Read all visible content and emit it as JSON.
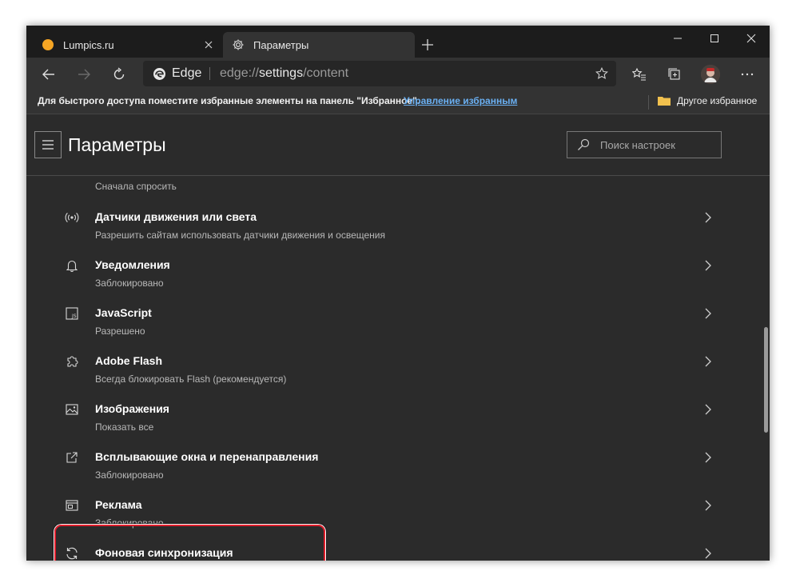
{
  "tabs": [
    {
      "title": "Lumpics.ru",
      "icon": "site-favicon-orange"
    },
    {
      "title": "Параметры",
      "icon": "gear-icon"
    }
  ],
  "window_controls": [
    "minimize",
    "maximize",
    "close"
  ],
  "address_bar": {
    "brand": "Edge",
    "url_scheme": "edge://",
    "url_host": "settings",
    "url_path": "/content"
  },
  "favorites_bar": {
    "message": "Для быстрого доступа поместите избранные элементы на панель \"Избранное\".",
    "manage_link": "Управление избранным",
    "other_favorites": "Другое избранное"
  },
  "settings": {
    "title": "Параметры",
    "search_placeholder": "Поиск настроек",
    "top_partial_subtitle": "Сначала спросить",
    "items": [
      {
        "title": "Датчики движения или света",
        "subtitle": "Разрешить сайтам использовать датчики движения и освещения",
        "icon": "sensor-icon"
      },
      {
        "title": "Уведомления",
        "subtitle": "Заблокировано",
        "icon": "bell-icon"
      },
      {
        "title": "JavaScript",
        "subtitle": "Разрешено",
        "icon": "javascript-icon"
      },
      {
        "title": "Adobe Flash",
        "subtitle": "Всегда блокировать Flash (рекомендуется)",
        "icon": "puzzle-icon"
      },
      {
        "title": "Изображения",
        "subtitle": "Показать все",
        "icon": "image-icon"
      },
      {
        "title": "Всплывающие окна и перенаправления",
        "subtitle": "Заблокировано",
        "icon": "popup-icon"
      },
      {
        "title": "Реклама",
        "subtitle": "Заблокировано",
        "icon": "ads-icon"
      },
      {
        "title": "Фоновая синхронизация",
        "subtitle": "",
        "icon": "sync-icon"
      }
    ]
  },
  "colors": {
    "highlight": "#e01e2c",
    "link": "#6ab0f3",
    "page_bg": "#2b2b2b",
    "toolbar_bg": "#333333"
  }
}
